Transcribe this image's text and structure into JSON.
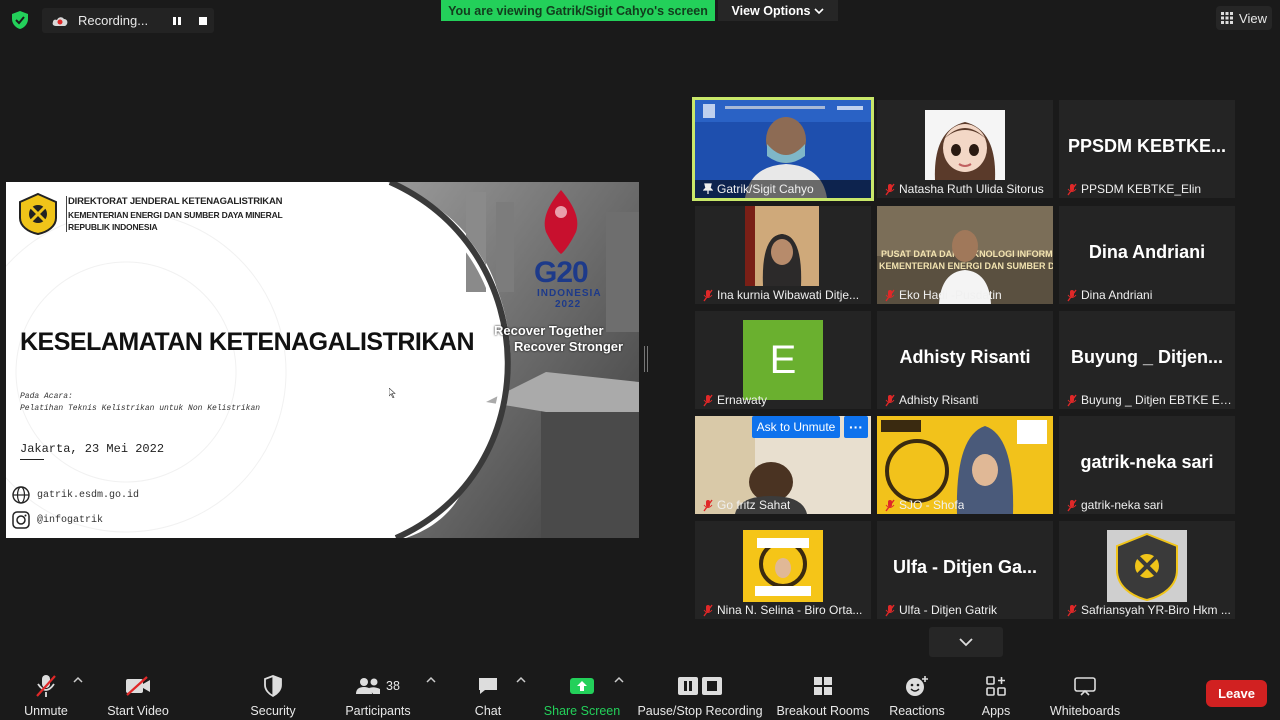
{
  "topbar": {
    "recording_label": "Recording...",
    "viewing_banner": "You are viewing Gatrik/Sigit Cahyo's screen",
    "view_options": "View Options",
    "view_button": "View"
  },
  "slide": {
    "org_line1": "DIREKTORAT JENDERAL KETENAGALISTRIKAN",
    "org_line2": "KEMENTERIAN ENERGI DAN SUMBER DAYA MINERAL",
    "org_line3": "REPUBLIK INDONESIA",
    "title": "KESELAMATAN KETENAGALISTRIKAN",
    "acara_label": "Pada Acara:",
    "acara": "Pelatihan Teknis Kelistrikan untuk Non Kelistrikan",
    "date": "Jakarta, 23 Mei 2022",
    "website": "gatrik.esdm.go.id",
    "instagram": "@infogatrik",
    "g20": "G20",
    "g20_country": "INDONESIA",
    "g20_year": "2022",
    "recover_line1": "Recover Together",
    "recover_line2": "Recover Stronger"
  },
  "gallery": {
    "tiles": [
      {
        "name": "Gatrik/Sigit Cahyo",
        "kind": "video",
        "pinned": true,
        "active": true
      },
      {
        "name": "Natasha Ruth Ulida Sitorus",
        "kind": "avatar",
        "muted": true
      },
      {
        "name": "PPSDM KEBTKE_Elin",
        "big": "PPSDM  KEBTKE...",
        "kind": "text",
        "muted": true
      },
      {
        "name": "Ina kurnia Wibawati Ditje...",
        "kind": "video",
        "muted": true
      },
      {
        "name": "Eko Hadi -Pusdatin",
        "kind": "video",
        "muted": true
      },
      {
        "name": "Dina Andriani",
        "big": "Dina Andriani",
        "kind": "text",
        "muted": true
      },
      {
        "name": "Ernawaty",
        "kind": "letter",
        "letter": "E",
        "muted": true
      },
      {
        "name": "Adhisty Risanti",
        "big": "Adhisty Risanti",
        "kind": "text",
        "muted": true
      },
      {
        "name": "Buyung _ Ditjen EBTKE ES...",
        "big": "Buyung _ Ditjen...",
        "kind": "text",
        "muted": true
      },
      {
        "name": "Go fritz Sahat",
        "kind": "video",
        "muted": true
      },
      {
        "name": "SJO - Shofa",
        "kind": "video",
        "muted": true
      },
      {
        "name": "gatrik-neka sari",
        "big": "gatrik-neka sari",
        "kind": "text",
        "muted": true
      },
      {
        "name": "Nina N. Selina - Biro Orta...",
        "kind": "avatar",
        "muted": true
      },
      {
        "name": "Ulfa - Ditjen Gatrik",
        "big": "Ulfa - Ditjen Ga...",
        "kind": "text",
        "muted": true
      },
      {
        "name": "Safriansyah YR-Biro Hkm ...",
        "kind": "avatar",
        "muted": true
      }
    ],
    "ask_unmute": "Ask to Unmute",
    "more": "···"
  },
  "toolbar": {
    "unmute": "Unmute",
    "start_video": "Start Video",
    "security": "Security",
    "participants": "Participants",
    "participants_count": "38",
    "chat": "Chat",
    "share_screen": "Share Screen",
    "pause_recording": "Pause/Stop Recording",
    "breakout": "Breakout Rooms",
    "reactions": "Reactions",
    "apps": "Apps",
    "whiteboards": "Whiteboards",
    "leave": "Leave"
  },
  "colors": {
    "banner_green": "#23d05a",
    "share_green": "#23d05a",
    "leave_red": "#d12121",
    "active_border": "#c9e86a",
    "ask_blue": "#0e72ed",
    "mute_red": "#e02828"
  }
}
